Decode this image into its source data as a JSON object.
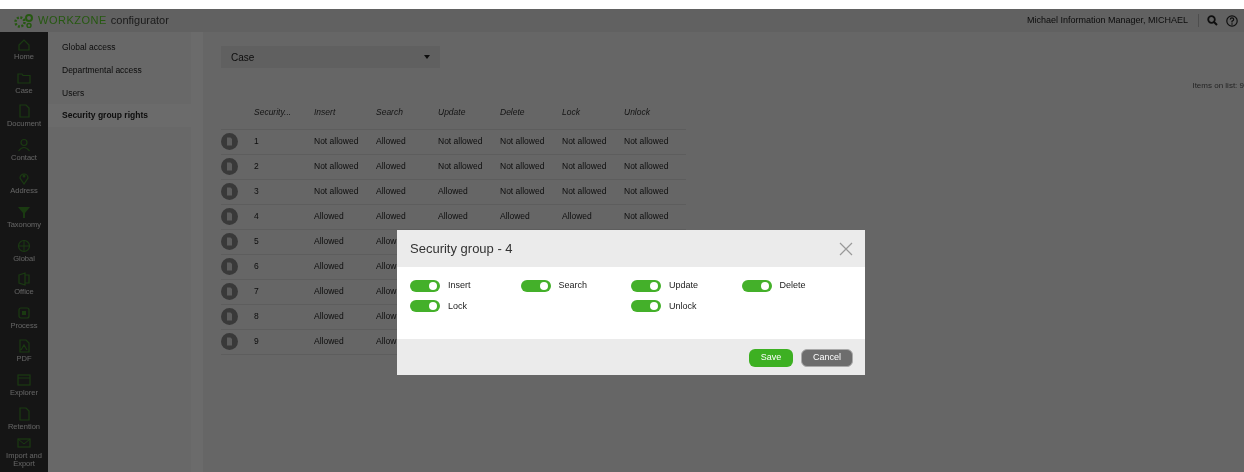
{
  "app": {
    "brand": "WORKZONE",
    "product": "configurator",
    "user": "Michael Information Manager, MICHAEL"
  },
  "rail": [
    {
      "label": "Home",
      "kind": "home"
    },
    {
      "label": "Case",
      "kind": "folder"
    },
    {
      "label": "Document",
      "kind": "doc"
    },
    {
      "label": "Contact",
      "kind": "person"
    },
    {
      "label": "Address",
      "kind": "pin"
    },
    {
      "label": "Taxonomy",
      "kind": "funnel"
    },
    {
      "label": "Global",
      "kind": "globe"
    },
    {
      "label": "Office",
      "kind": "office"
    },
    {
      "label": "Process",
      "kind": "process"
    },
    {
      "label": "PDF",
      "kind": "pdf"
    },
    {
      "label": "Explorer",
      "kind": "window"
    },
    {
      "label": "Retention",
      "kind": "doc"
    },
    {
      "label": "Import and Export",
      "kind": "mail"
    }
  ],
  "nav": [
    {
      "label": "Global access",
      "selected": false
    },
    {
      "label": "Departmental access",
      "selected": false
    },
    {
      "label": "Users",
      "selected": false
    },
    {
      "label": "Security group rights",
      "selected": true
    }
  ],
  "dropdown": {
    "value": "Case"
  },
  "items_count": "Items on list: 9",
  "table": {
    "columns": [
      "Security...",
      "Insert",
      "Search",
      "Update",
      "Delete",
      "Lock",
      "Unlock"
    ],
    "rows": [
      [
        "1",
        "Not allowed",
        "Allowed",
        "Not allowed",
        "Not allowed",
        "Not allowed",
        "Not allowed"
      ],
      [
        "2",
        "Not allowed",
        "Allowed",
        "Not allowed",
        "Not allowed",
        "Not allowed",
        "Not allowed"
      ],
      [
        "3",
        "Not allowed",
        "Allowed",
        "Allowed",
        "Not allowed",
        "Not allowed",
        "Not allowed"
      ],
      [
        "4",
        "Allowed",
        "Allowed",
        "Allowed",
        "Allowed",
        "Allowed",
        "Not allowed"
      ],
      [
        "5",
        "Allowed",
        "Allow"
      ],
      [
        "6",
        "Allowed",
        "Allow"
      ],
      [
        "7",
        "Allowed",
        "Allow"
      ],
      [
        "8",
        "Allowed",
        "Allow"
      ],
      [
        "9",
        "Allowed",
        "Allow"
      ]
    ]
  },
  "dialog": {
    "title": "Security group - 4",
    "toggle_rows": [
      [
        {
          "label": "Insert",
          "on": true
        },
        {
          "label": "Search",
          "on": true
        },
        {
          "label": "Update",
          "on": true
        },
        {
          "label": "Delete",
          "on": true
        }
      ],
      [
        {
          "label": "Lock",
          "on": true
        },
        {
          "label": "Unlock",
          "on": true
        }
      ]
    ],
    "buttons": [
      {
        "label": "Save",
        "kind": "primary"
      },
      {
        "label": "Cancel",
        "kind": "secondary"
      }
    ]
  }
}
